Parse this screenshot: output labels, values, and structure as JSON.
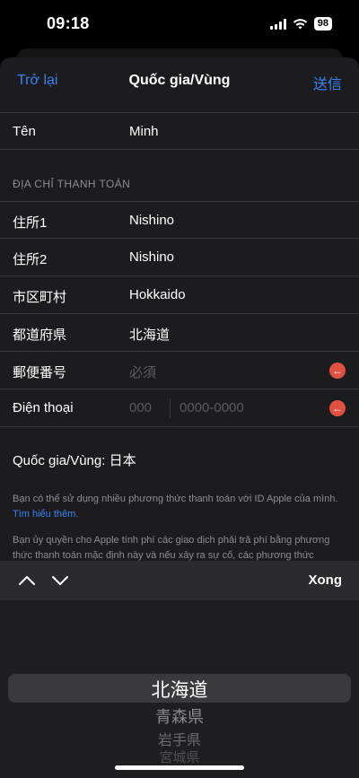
{
  "status": {
    "time": "09:18",
    "battery": "98"
  },
  "nav": {
    "back": "Trở lại",
    "title": "Quốc gia/Vùng",
    "send": "送信"
  },
  "name_row": {
    "label": "Tên",
    "value": "Minh"
  },
  "billing": {
    "header": "ĐỊA CHỈ THANH TOÁN",
    "rows": [
      {
        "label": "住所1",
        "value": "Nishino"
      },
      {
        "label": "住所2",
        "value": "Nishino"
      },
      {
        "label": "市区町村",
        "value": "Hokkaido"
      },
      {
        "label": "都道府県",
        "value": "北海道"
      }
    ],
    "postal": {
      "label": "郵便番号",
      "placeholder": "必須"
    },
    "phone": {
      "label": "Điện thoại",
      "placeholder_code": "000",
      "placeholder_number": "0000-0000"
    }
  },
  "country": "Quốc gia/Vùng: 日本",
  "info1": {
    "text": "Bạn có thể sử dụng nhiều phương thức thanh toán với ID Apple của mình.",
    "link": "Tìm hiểu thêm."
  },
  "info2": "Bạn ủy quyền cho Apple tính phí các giao dịch phải trả phí bằng phương thức thanh toán mặc định này và nếu xảy ra sự cố, các phương thức",
  "toolbar": {
    "done": "Xong"
  },
  "picker": {
    "selected": "北海道",
    "items": [
      "青森県",
      "岩手県",
      "宮城県"
    ]
  },
  "colors": {
    "accent": "#3b82f6",
    "alert": "#e0513f"
  },
  "icons": [
    "signal-icon",
    "wifi-icon",
    "battery-icon",
    "alert-icon",
    "chevron-up-icon",
    "chevron-down-icon"
  ]
}
